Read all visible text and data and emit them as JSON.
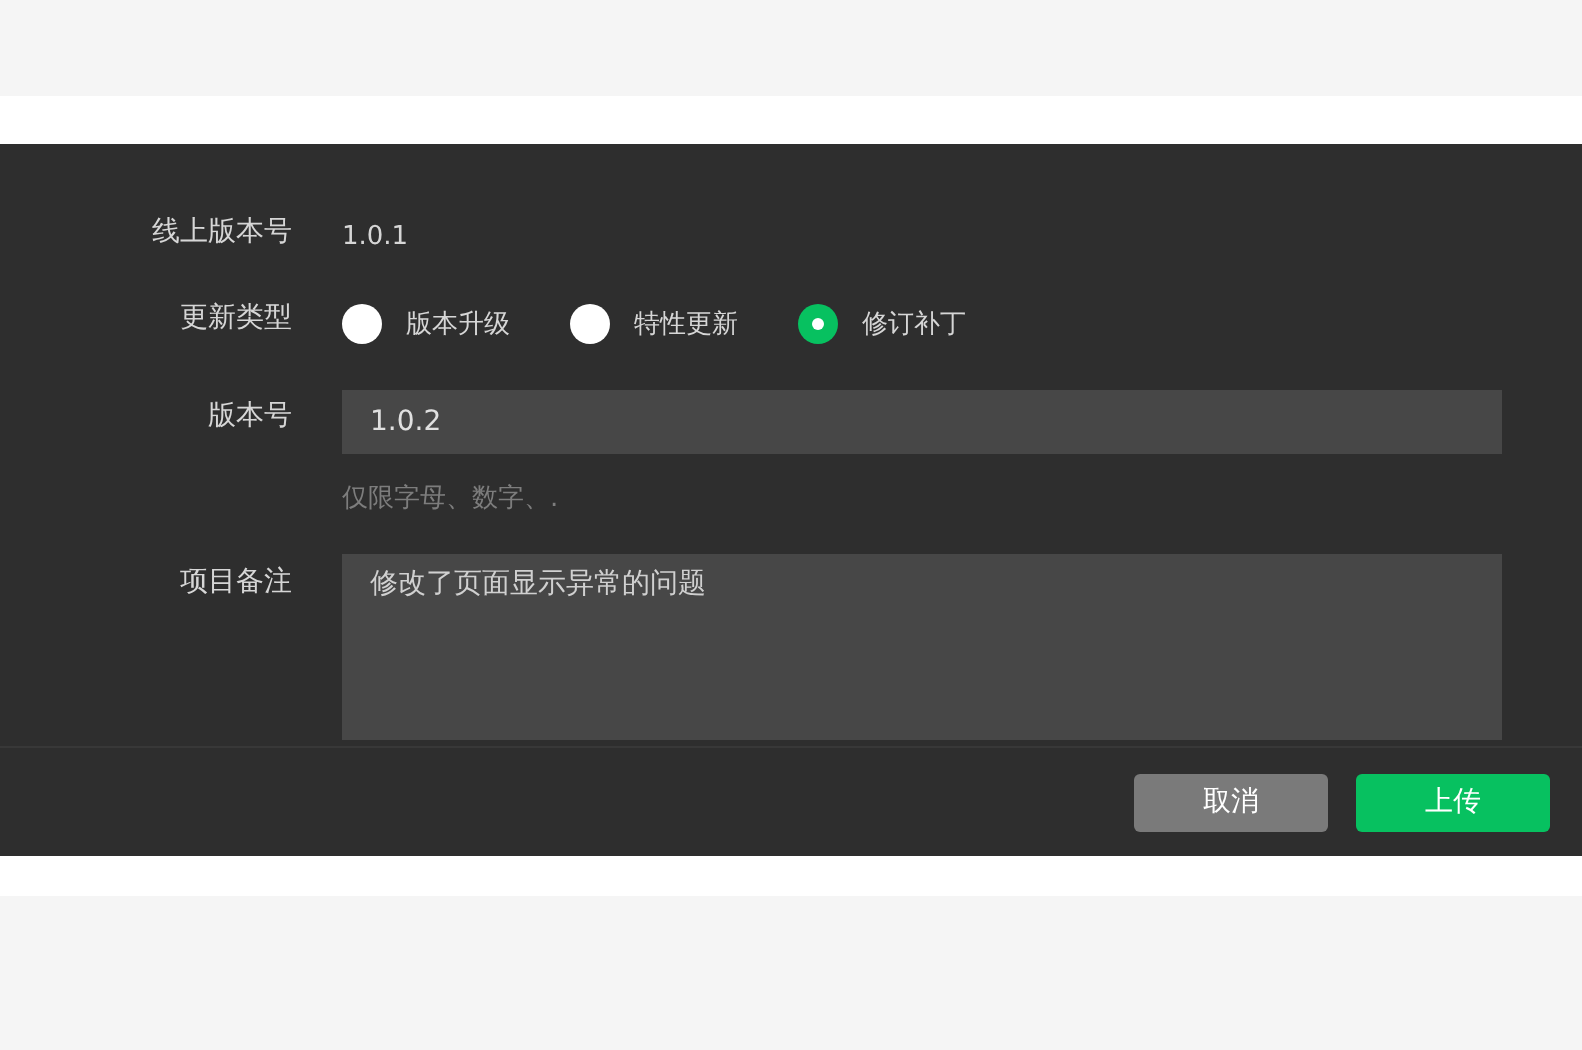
{
  "form": {
    "online_version": {
      "label": "线上版本号",
      "value": "1.0.1"
    },
    "update_type": {
      "label": "更新类型",
      "options": [
        {
          "label": "版本升级",
          "selected": false
        },
        {
          "label": "特性更新",
          "selected": false
        },
        {
          "label": "修订补丁",
          "selected": true
        }
      ]
    },
    "version": {
      "label": "版本号",
      "value": "1.0.2",
      "hint": "仅限字母、数字、."
    },
    "notes": {
      "label": "项目备注",
      "value": "修改了页面显示异常的问题"
    }
  },
  "buttons": [
    {
      "label": "取消",
      "kind": "secondary"
    },
    {
      "label": "上传",
      "kind": "primary"
    }
  ]
}
